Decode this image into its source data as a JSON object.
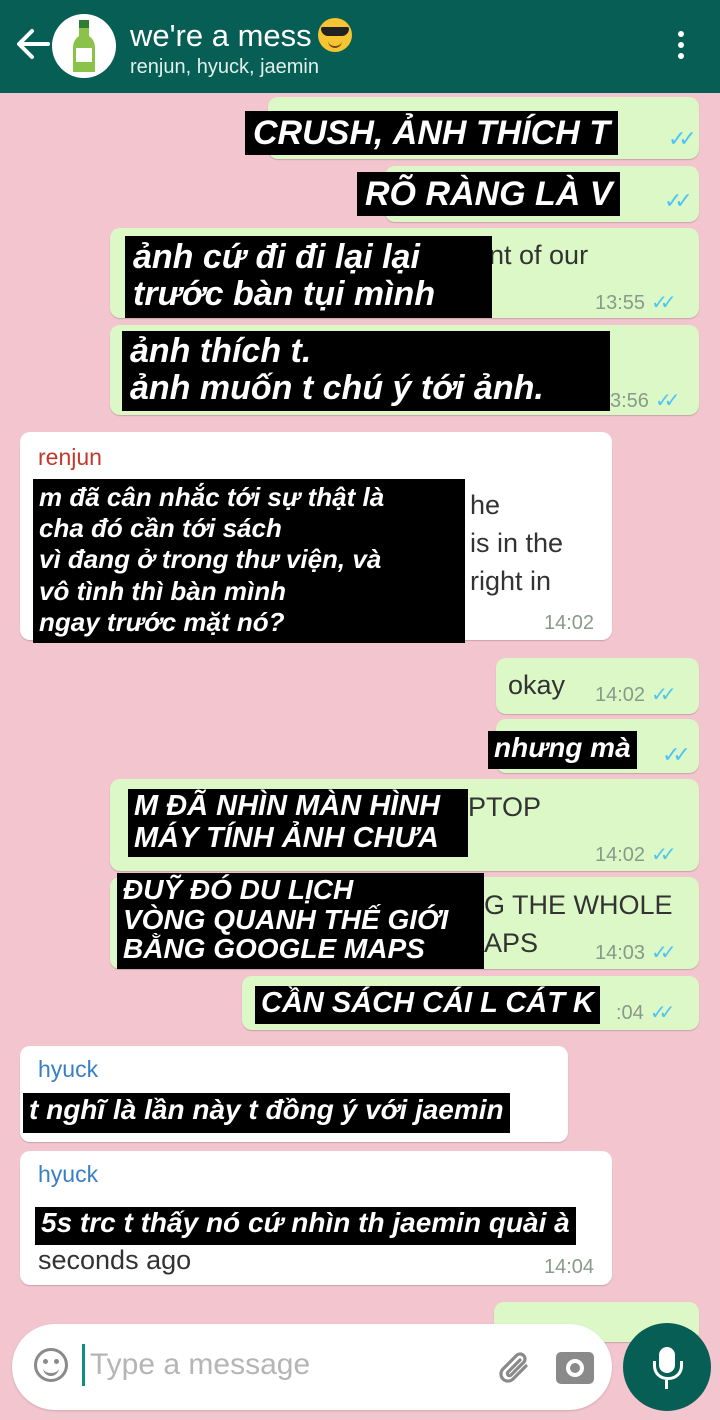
{
  "header": {
    "title": "we're a mess",
    "subtitle": "renjun, hyuck, jaemin"
  },
  "messages": {
    "m1": {
      "overlay": "CRUSH, ẢNH THÍCH T"
    },
    "m2": {
      "overlay": "RÕ RÀNG LÀ V"
    },
    "m3": {
      "under": "nt of our",
      "overlay": [
        "ảnh cứ đi đi lại lại",
        "trước bàn tụi mình"
      ],
      "time": "13:55"
    },
    "m4": {
      "overlay": [
        "ảnh thích t.",
        "ảnh muốn t chú ý tới ảnh."
      ],
      "time": "3:56"
    },
    "m5": {
      "sender": "renjun",
      "under": [
        "he",
        "is in the",
        "right in"
      ],
      "overlay": [
        "m đã cân nhắc tới sự thật là",
        "cha đó cần tới sách",
        "vì đang ở trong thư viện, và",
        "vô tình thì bàn mình",
        "ngay trước mặt nó?"
      ],
      "time": "14:02"
    },
    "m6": {
      "text": "okay",
      "time": "14:02"
    },
    "m7": {
      "overlay": "nhưng mà"
    },
    "m8": {
      "under": "PTOP",
      "overlay": [
        "M ĐÃ NHÌN MÀN HÌNH",
        "MÁY TÍNH ẢNH CHƯA"
      ],
      "time": "14:02"
    },
    "m9": {
      "under": [
        "G THE WHOLE",
        "APS"
      ],
      "overlay": [
        "ĐUỸ ĐÓ DU LỊCH",
        "VÒNG QUANH THẾ GIỚI",
        "BẰNG GOOGLE MAPS"
      ],
      "time": "14:03"
    },
    "m10": {
      "overlay": "CẦN SÁCH CÁI L CÁT K",
      "time": ":04"
    },
    "m11": {
      "sender": "hyuck",
      "overlay": "t nghĩ là lần này t đồng ý với jaemin"
    },
    "m12": {
      "sender": "hyuck",
      "overlay": "5s trc t thấy nó cứ nhìn th jaemin quài à",
      "text": "seconds ago",
      "time": "14:04"
    }
  },
  "input": {
    "placeholder": "Type a message"
  },
  "colors": {
    "header": "#075e54",
    "chat_bg": "#f3c5cf",
    "outgoing": "#dcf8c6",
    "incoming": "#ffffff",
    "renjun": "#c0392b",
    "hyuck": "#3a7fc1",
    "read_ticks": "#4fc3f7"
  },
  "icons": [
    "back-arrow-icon",
    "group-avatar-icon",
    "sunglasses-emoji-icon",
    "more-options-icon",
    "read-ticks-icon",
    "emoji-icon",
    "attach-icon",
    "camera-icon",
    "mic-icon"
  ]
}
